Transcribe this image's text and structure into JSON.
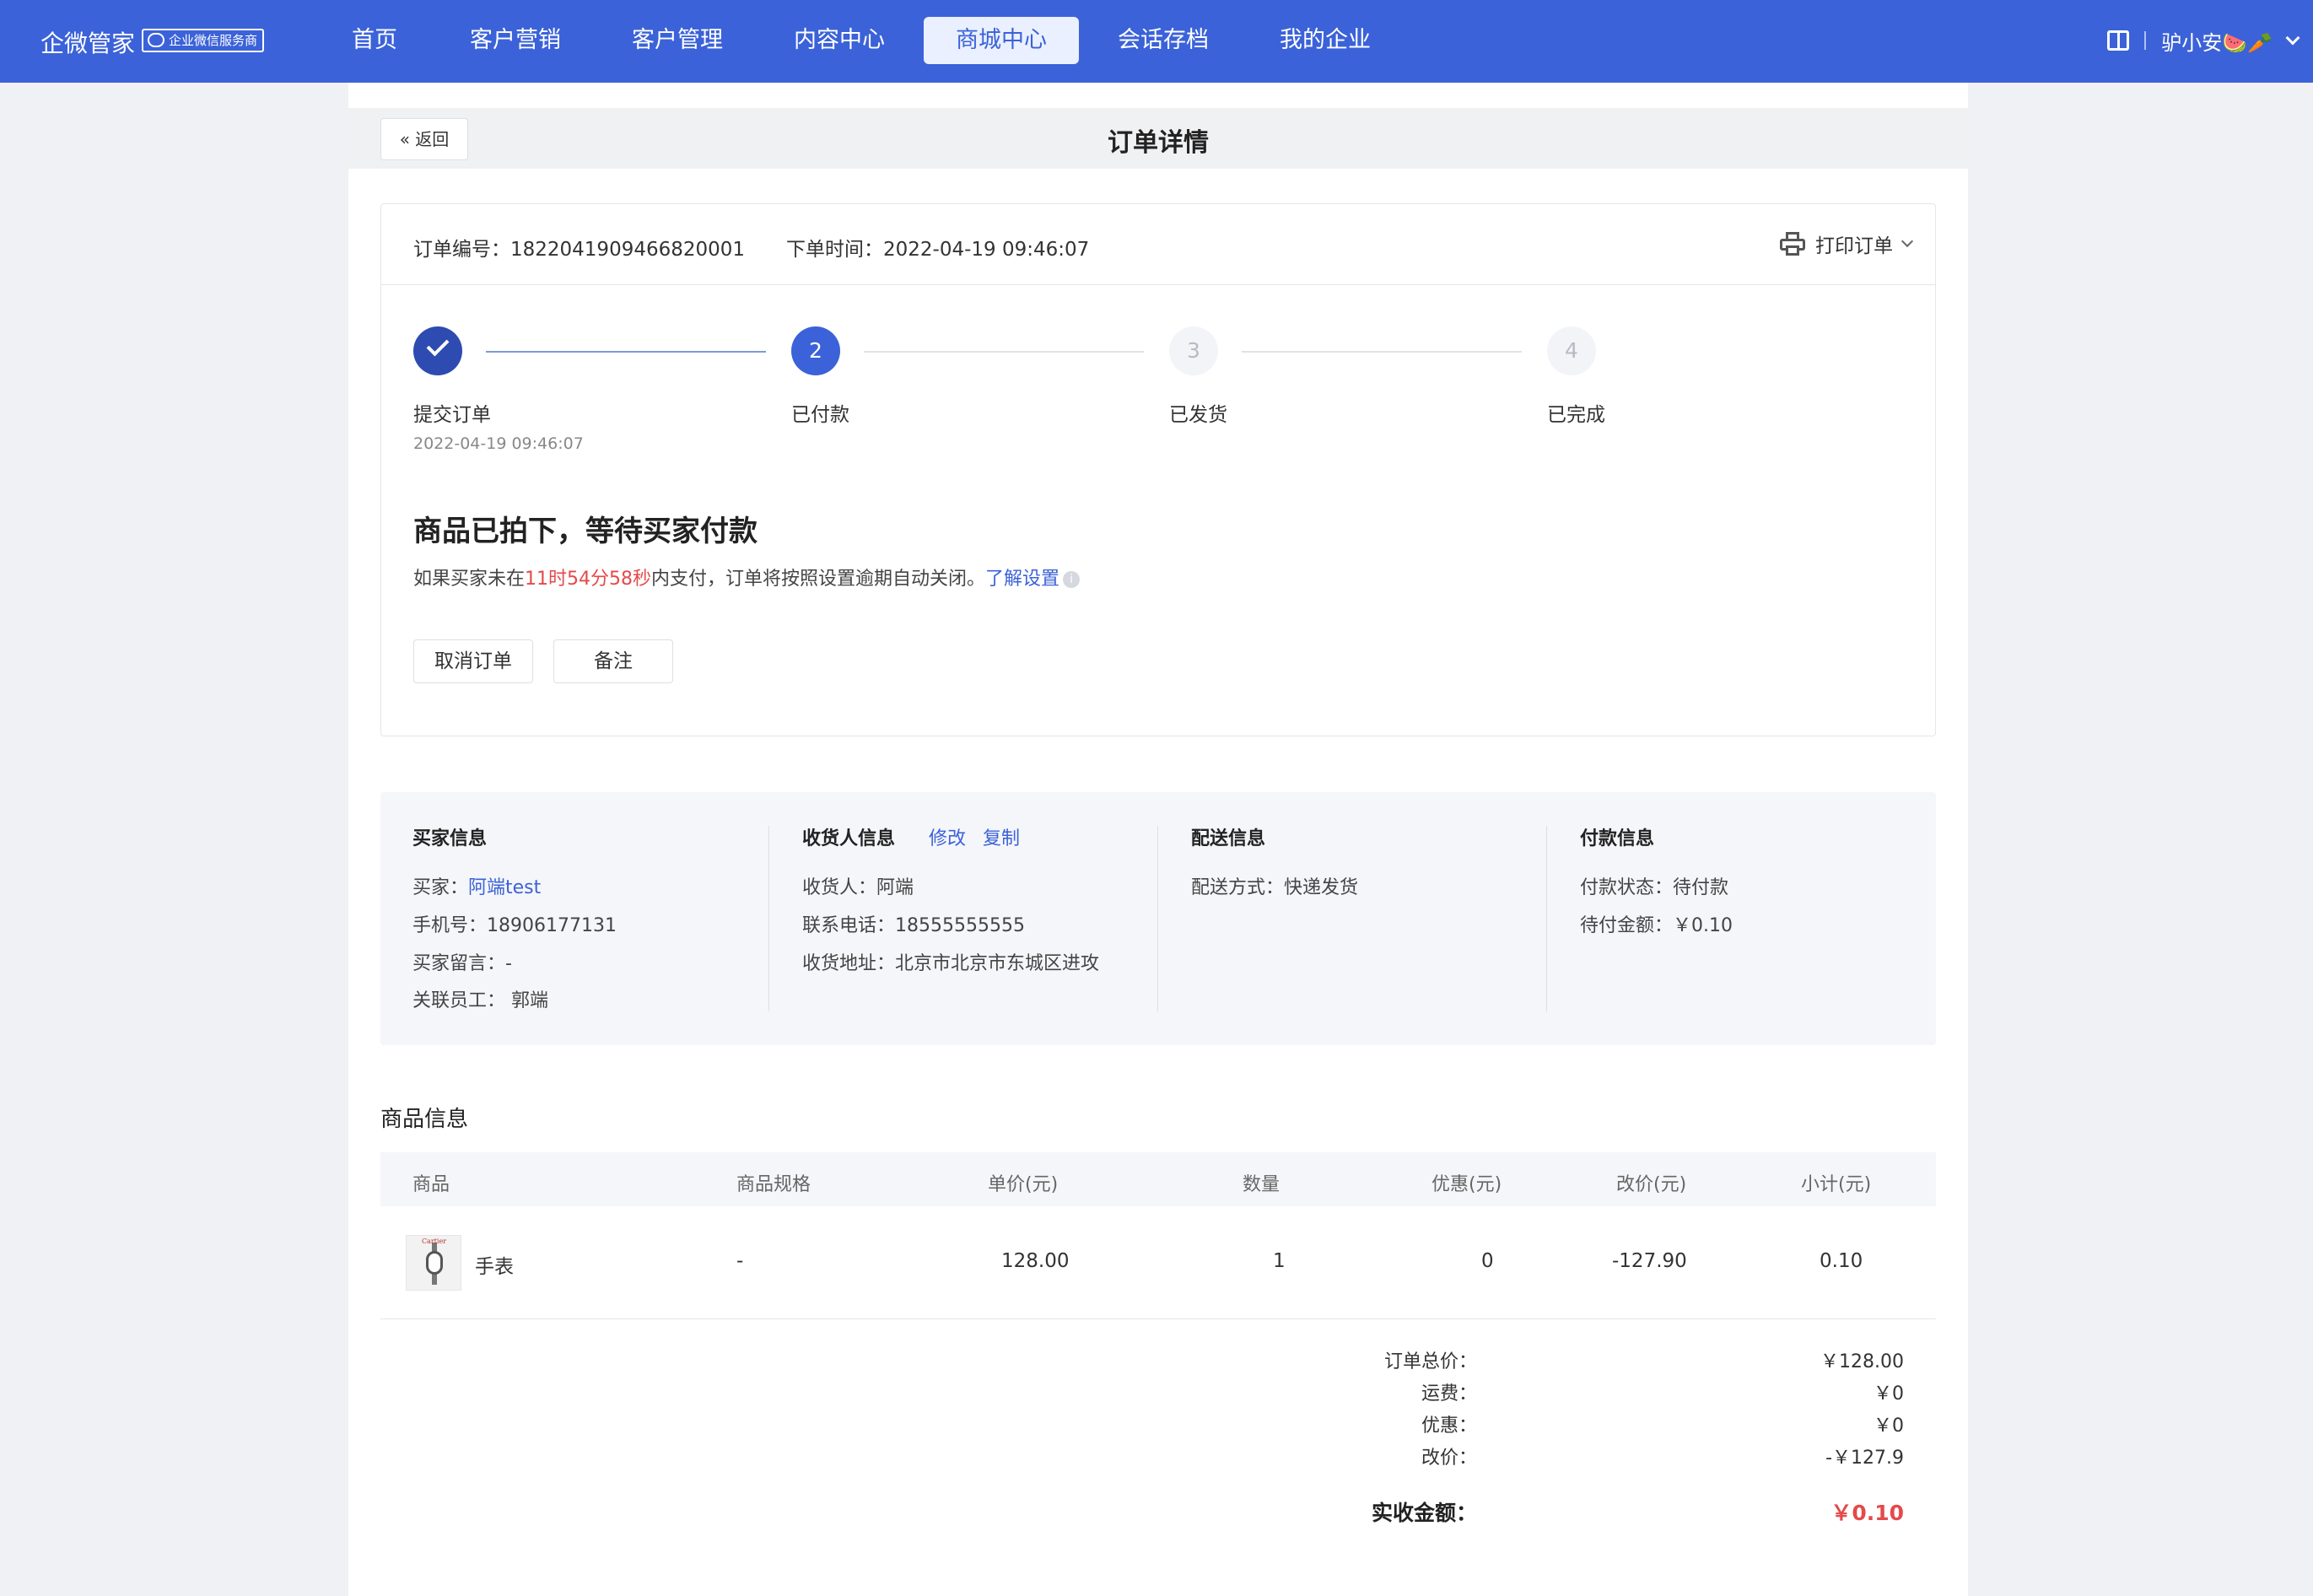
{
  "nav": {
    "brand": "企微管家",
    "badge": "企业微信服务商",
    "items": [
      "首页",
      "客户营销",
      "客户管理",
      "内容中心",
      "商城中心",
      "会话存档",
      "我的企业"
    ],
    "active_index": 4,
    "username": "驴小安🍉🥕"
  },
  "page": {
    "back_label": "返回",
    "title": "订单详情"
  },
  "order": {
    "number_label": "订单编号：",
    "number": "1822041909466820001",
    "time_label": "下单时间：",
    "time": "2022-04-19 09:46:07",
    "print_label": "打印订单"
  },
  "steps": [
    {
      "num": "",
      "label": "提交订单",
      "time": "2022-04-19 09:46:07",
      "state": "done"
    },
    {
      "num": "2",
      "label": "已付款",
      "time": "",
      "state": "current"
    },
    {
      "num": "3",
      "label": "已发货",
      "time": "",
      "state": "todo"
    },
    {
      "num": "4",
      "label": "已完成",
      "time": "",
      "state": "todo"
    }
  ],
  "status": {
    "title": "商品已拍下，等待买家付款",
    "desc_pre": "如果买家未在",
    "countdown": "11时54分58秒",
    "desc_post": "内支付，订单将按照设置逾期自动关闭。",
    "link": "了解设置",
    "info_glyph": "i"
  },
  "actions": {
    "cancel": "取消订单",
    "remark": "备注"
  },
  "buyer": {
    "title": "买家信息",
    "buyer_label": "买家：",
    "buyer_name": "阿端test",
    "phone": "手机号：18906177131",
    "message": "买家留言：-",
    "staff": "关联员工： 郭端"
  },
  "receiver": {
    "title": "收货人信息",
    "edit": "修改",
    "copy": "复制",
    "name": "收货人：阿端",
    "phone": "联系电话：18555555555",
    "address": "收货地址：北京市北京市东城区进攻"
  },
  "delivery": {
    "title": "配送信息",
    "method": "配送方式：快递发货"
  },
  "payment": {
    "title": "付款信息",
    "status": "付款状态：待付款",
    "amount": "待付金额：￥0.10"
  },
  "products": {
    "title": "商品信息",
    "headers": [
      "商品",
      "商品规格",
      "单价(元)",
      "数量",
      "优惠(元)",
      "改价(元)",
      "小计(元)"
    ],
    "rows": [
      {
        "name": "手表",
        "spec": "-",
        "price": "128.00",
        "qty": "1",
        "discount": "0",
        "adjust": "-127.90",
        "subtotal": "0.10",
        "thumb_brand": "Cartier"
      }
    ]
  },
  "summary": {
    "total_label": "订单总价：",
    "total": "￥128.00",
    "shipping_label": "运费：",
    "shipping": "￥0",
    "discount_label": "优惠：",
    "discount": "￥0",
    "adjust_label": "改价：",
    "adjust": "-￥127.9",
    "received_label": "实收金额：",
    "received": "￥0.10"
  },
  "colors": {
    "primary": "#3b62d8",
    "danger": "#e44a4a"
  }
}
